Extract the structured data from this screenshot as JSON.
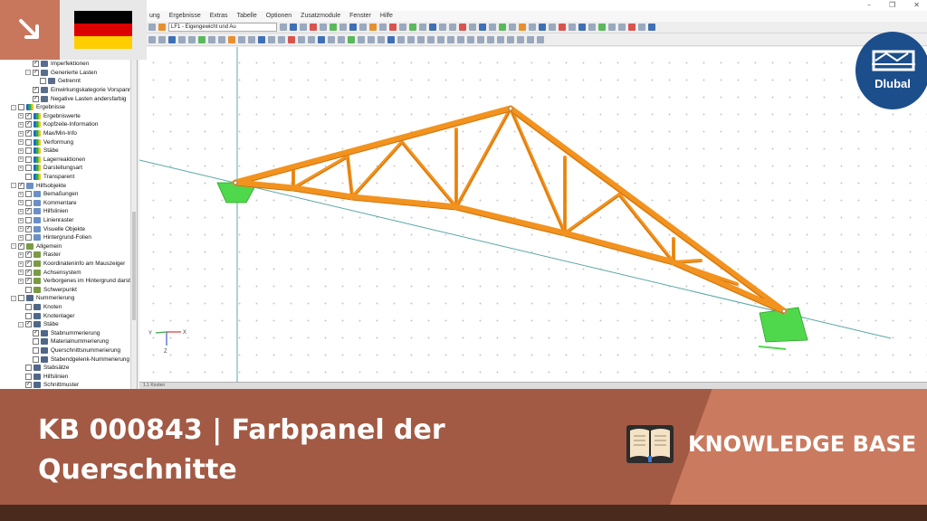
{
  "window": {
    "controls": [
      "–",
      "❐",
      "✕"
    ]
  },
  "menu": [
    "ung",
    "Ergebnisse",
    "Extras",
    "Tabelle",
    "Optionen",
    "Zusatzmodule",
    "Fenster",
    "Hilfe"
  ],
  "toolbar": {
    "load_case": "LF1 - Eigengewicht und Au"
  },
  "navigator": {
    "items": [
      {
        "indent": 3,
        "exp": "",
        "cb": "✓",
        "icon": "load",
        "label": "Imperfektionen"
      },
      {
        "indent": 3,
        "exp": "-",
        "cb": "✓",
        "icon": "load",
        "label": "Generierte Lasten"
      },
      {
        "indent": 4,
        "exp": "",
        "cb": "",
        "icon": "load",
        "label": "Getrennt"
      },
      {
        "indent": 3,
        "exp": "",
        "cb": "✓",
        "icon": "load",
        "label": "Einwirkungskategorie Vorspannung"
      },
      {
        "indent": 3,
        "exp": "",
        "cb": "✓",
        "icon": "load",
        "label": "Negative Lasten andersfarbig"
      },
      {
        "indent": 1,
        "exp": "-",
        "cb": "",
        "icon": "res",
        "label": "Ergebnisse"
      },
      {
        "indent": 2,
        "exp": "+",
        "cb": "✓",
        "icon": "res",
        "label": "Ergebniswerte"
      },
      {
        "indent": 2,
        "exp": "+",
        "cb": "✓",
        "icon": "res",
        "label": "Kopfzeile-Information"
      },
      {
        "indent": 2,
        "exp": "+",
        "cb": "✓",
        "icon": "res",
        "label": "Max/Min-Info"
      },
      {
        "indent": 2,
        "exp": "+",
        "cb": "",
        "icon": "res",
        "label": "Verformung"
      },
      {
        "indent": 2,
        "exp": "+",
        "cb": "",
        "icon": "res",
        "label": "Stäbe"
      },
      {
        "indent": 2,
        "exp": "+",
        "cb": "",
        "icon": "res",
        "label": "Lagerreaktionen"
      },
      {
        "indent": 2,
        "exp": "+",
        "cb": "",
        "icon": "res",
        "label": "Darstellungsart"
      },
      {
        "indent": 2,
        "exp": "",
        "cb": "",
        "icon": "res",
        "label": "Transparent"
      },
      {
        "indent": 1,
        "exp": "-",
        "cb": "✓",
        "icon": "helper",
        "label": "Hilfsobjekte"
      },
      {
        "indent": 2,
        "exp": "+",
        "cb": "",
        "icon": "helper",
        "label": "Bemaßungen"
      },
      {
        "indent": 2,
        "exp": "+",
        "cb": "",
        "icon": "helper",
        "label": "Kommentare"
      },
      {
        "indent": 2,
        "exp": "+",
        "cb": "✓",
        "icon": "helper",
        "label": "Hilfslinien"
      },
      {
        "indent": 2,
        "exp": "+",
        "cb": "",
        "icon": "helper",
        "label": "Linienraster"
      },
      {
        "indent": 2,
        "exp": "+",
        "cb": "✓",
        "icon": "helper",
        "label": "Visuelle Objekte"
      },
      {
        "indent": 2,
        "exp": "+",
        "cb": "",
        "icon": "helper",
        "label": "Hintergrund-Folien"
      },
      {
        "indent": 1,
        "exp": "-",
        "cb": "✓",
        "icon": "gen",
        "label": "Allgemein"
      },
      {
        "indent": 2,
        "exp": "+",
        "cb": "✓",
        "icon": "gen",
        "label": "Raster"
      },
      {
        "indent": 2,
        "exp": "+",
        "cb": "✓",
        "icon": "gen",
        "label": "Koordinateninfo am Mauszeiger"
      },
      {
        "indent": 2,
        "exp": "+",
        "cb": "✓",
        "icon": "gen",
        "label": "Achsensystem"
      },
      {
        "indent": 2,
        "exp": "+",
        "cb": "✓",
        "icon": "gen",
        "label": "Verborgenes im Hintergrund darstellen"
      },
      {
        "indent": 2,
        "exp": "",
        "cb": "",
        "icon": "gen",
        "label": "Schwerpunkt"
      },
      {
        "indent": 1,
        "exp": "-",
        "cb": "",
        "icon": "num",
        "label": "Nummerierung"
      },
      {
        "indent": 2,
        "exp": "",
        "cb": "",
        "icon": "num",
        "label": "Knoten"
      },
      {
        "indent": 2,
        "exp": "",
        "cb": "",
        "icon": "num",
        "label": "Knotenlager"
      },
      {
        "indent": 2,
        "exp": "-",
        "cb": "✓",
        "icon": "num",
        "label": "Stäbe"
      },
      {
        "indent": 3,
        "exp": "",
        "cb": "✓",
        "icon": "num",
        "label": "Stabnummerierung"
      },
      {
        "indent": 3,
        "exp": "",
        "cb": "",
        "icon": "num",
        "label": "Materialnummerierung"
      },
      {
        "indent": 3,
        "exp": "",
        "cb": "",
        "icon": "num",
        "label": "Querschnittsnummerierung"
      },
      {
        "indent": 3,
        "exp": "",
        "cb": "",
        "icon": "num",
        "label": "Stabendgelenk-Nummerierung"
      },
      {
        "indent": 2,
        "exp": "",
        "cb": "",
        "icon": "num",
        "label": "Stabsätze"
      },
      {
        "indent": 2,
        "exp": "",
        "cb": "",
        "icon": "num",
        "label": "Hilfslinien"
      },
      {
        "indent": 2,
        "exp": "",
        "cb": "✓",
        "icon": "num",
        "label": "Schnittmuster"
      }
    ]
  },
  "viewport": {
    "axes": {
      "x": "X",
      "y": "Y",
      "z": "Z"
    },
    "member_color": "#f2921f",
    "member_edge_color": "#c96d0c",
    "support_color": "#4fd84b",
    "guide_line_color": "#5aa7a4"
  },
  "panel": {
    "label": "1.1 Knoten"
  },
  "flag_colors": [
    "#000000",
    "#dd0000",
    "#ffce00"
  ],
  "logo": {
    "text": "Dlubal"
  },
  "banner": {
    "title": "KB 000843 | Farbpanel der Querschnitte",
    "badge": "KNOWLEDGE BASE",
    "icon": "open-book-icon"
  },
  "colors": {
    "banner": "#a25a45",
    "banner_accent": "#c97a5f",
    "bottom_bar": "#4b2a1e",
    "brand_blue": "#1d4e8c"
  }
}
